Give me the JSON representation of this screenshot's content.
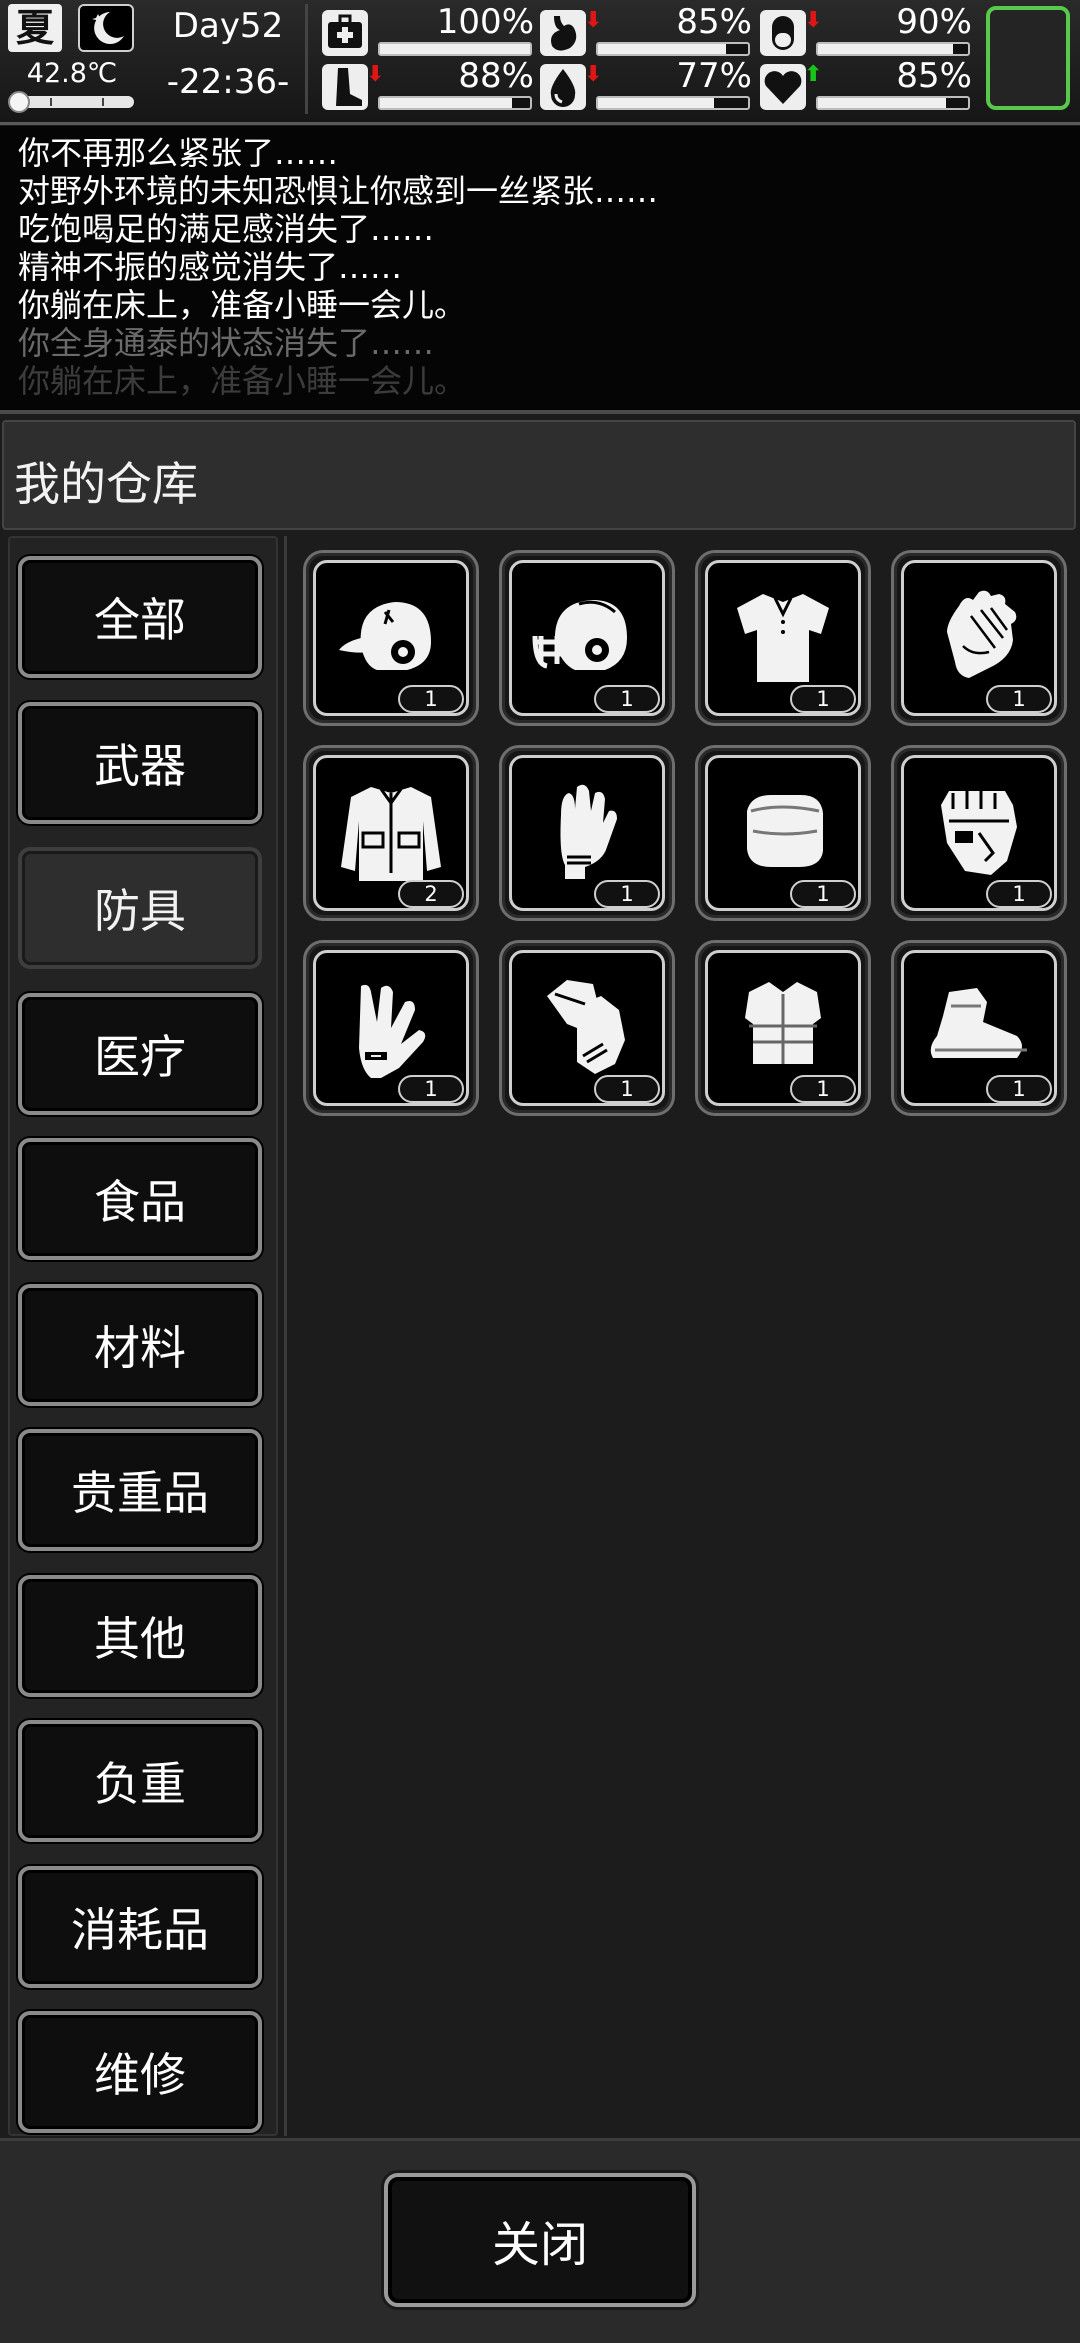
{
  "hud": {
    "season": "夏",
    "temperature": "42.8℃",
    "day": "Day52",
    "time": "-22:36-",
    "stats": [
      {
        "name": "health",
        "icon": "first-aid-icon",
        "arrow": "",
        "value": "100%",
        "level": 1.0
      },
      {
        "name": "hunger",
        "icon": "stomach-icon",
        "arrow": "down",
        "value": "85%",
        "level": 0.85
      },
      {
        "name": "capsule",
        "icon": "pill-icon",
        "arrow": "down",
        "value": "90%",
        "level": 0.9
      },
      {
        "name": "stamina",
        "icon": "leg-icon",
        "arrow": "down",
        "value": "88%",
        "level": 0.88
      },
      {
        "name": "thirst",
        "icon": "water-drop-icon",
        "arrow": "down",
        "value": "77%",
        "level": 0.77
      },
      {
        "name": "mood",
        "icon": "heart-icon",
        "arrow": "up",
        "value": "85%",
        "level": 0.85
      }
    ],
    "arrow_colors": {
      "down": "#e01515",
      "up": "#19c419"
    },
    "portrait_border_color": "#58c94a"
  },
  "log": [
    {
      "text": "你不再那么紧张了……",
      "dim": false
    },
    {
      "text": "对野外环境的未知恐惧让你感到一丝紧张……",
      "dim": false
    },
    {
      "text": "吃饱喝足的满足感消失了……",
      "dim": false
    },
    {
      "text": "精神不振的感觉消失了……",
      "dim": false
    },
    {
      "text": "你躺在床上，准备小睡一会儿。",
      "dim": false
    },
    {
      "text": "你全身通泰的状态消失了……",
      "dim": true
    },
    {
      "text": "你躺在床上，准备小睡一会儿。",
      "dim": true
    }
  ],
  "warehouse": {
    "title": "我的仓库",
    "categories": [
      "全部",
      "武器",
      "防具",
      "医疗",
      "食品",
      "材料",
      "贵重品",
      "其他",
      "负重",
      "消耗品",
      "维修"
    ],
    "active_category": "防具",
    "items": [
      {
        "icon": "baseball-helmet-icon",
        "qty": "1"
      },
      {
        "icon": "football-helmet-icon",
        "qty": "1"
      },
      {
        "icon": "shirt-icon",
        "qty": "1"
      },
      {
        "icon": "glove-icon",
        "qty": "1"
      },
      {
        "icon": "jacket-icon",
        "qty": "2"
      },
      {
        "icon": "padded-glove-icon",
        "qty": "1"
      },
      {
        "icon": "fur-muff-icon",
        "qty": "1"
      },
      {
        "icon": "fingerless-glove-icon",
        "qty": "1"
      },
      {
        "icon": "work-glove-icon",
        "qty": "1"
      },
      {
        "icon": "mitten-pair-icon",
        "qty": "1"
      },
      {
        "icon": "fur-vest-icon",
        "qty": "1"
      },
      {
        "icon": "fur-boots-icon",
        "qty": "1"
      }
    ]
  },
  "footer": {
    "close_label": "关闭"
  }
}
